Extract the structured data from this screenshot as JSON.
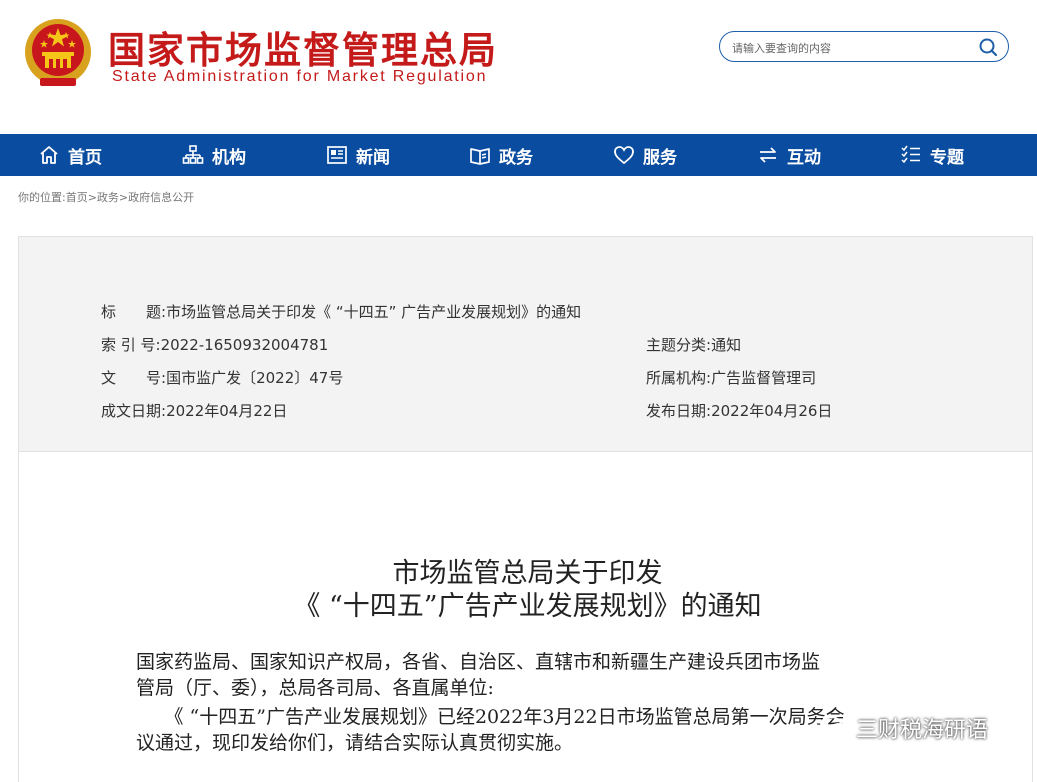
{
  "header": {
    "title_cn": "国家市场监督管理总局",
    "title_en": "State Administration for Market Regulation",
    "search_placeholder": "请输入要查询的内容"
  },
  "nav": [
    {
      "label": "首页",
      "icon": "home-icon"
    },
    {
      "label": "机构",
      "icon": "org-chart-icon"
    },
    {
      "label": "新闻",
      "icon": "news-icon"
    },
    {
      "label": "政务",
      "icon": "book-icon"
    },
    {
      "label": "服务",
      "icon": "heart-icon"
    },
    {
      "label": "互动",
      "icon": "exchange-icon"
    },
    {
      "label": "专题",
      "icon": "list-icon"
    }
  ],
  "breadcrumb": "你的位置:首页>政务>政府信息公开",
  "meta": {
    "title_label": "标　　题:",
    "title_value": "市场监管总局关于印发《 “十四五” 广告产业发展规划》的通知",
    "index_label": "索 引 号:",
    "index_value": "2022-1650932004781",
    "topic_label": "主题分类:",
    "topic_value": "通知",
    "docno_label": "文　　号:",
    "docno_value": "国市监广发〔2022〕47号",
    "org_label": "所属机构:",
    "org_value": "广告监督管理司",
    "created_label": "成文日期:",
    "created_value": "2022年04月22日",
    "published_label": "发布日期:",
    "published_value": "2022年04月26日"
  },
  "document": {
    "title_line1": "市场监管总局关于印发",
    "title_line2": "《 “十四五”广告产业发展规划》的通知",
    "recipients_line1": "国家药监局、国家知识产权局，各省、自治区、直辖市和新疆生产建设兵团市场监",
    "recipients_line2": "管局（厅、委），总局各司局、各直属单位:",
    "para1_line1": "　　《 “十四五”广告产业发展规划》已经2022年3月22日市场监管总局第一次局务会",
    "para1_line2": "议通过，现印发给你们，请结合实际认真贯彻实施。"
  },
  "watermark": "三财税海研语",
  "colors": {
    "brand_red": "#c41a1a",
    "nav_blue": "#0a4c9f"
  }
}
